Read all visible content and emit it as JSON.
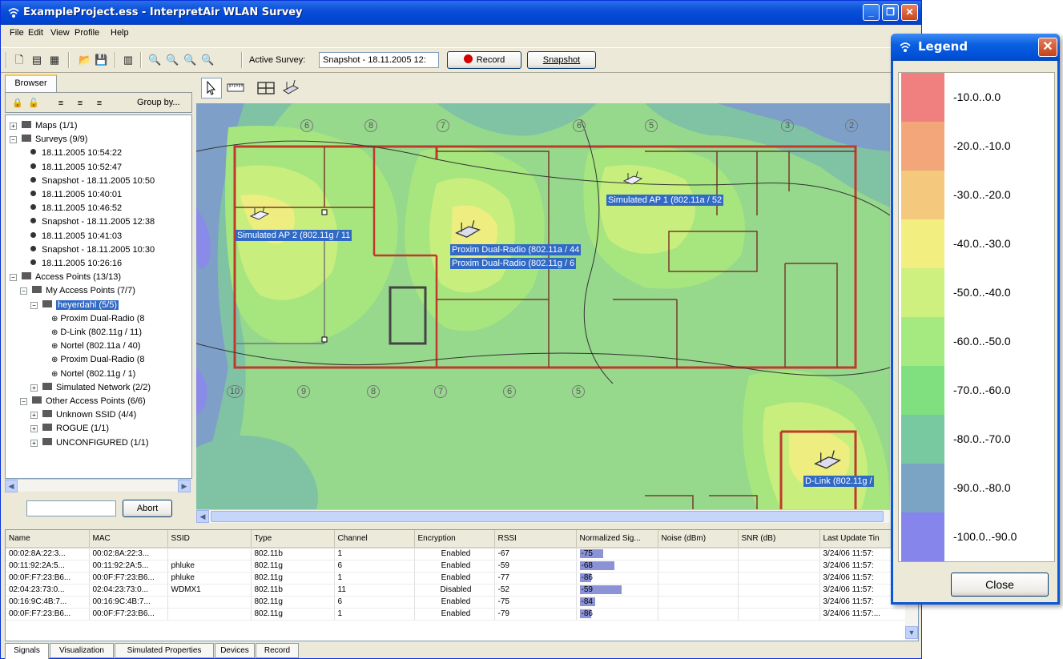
{
  "window": {
    "title": "ExampleProject.ess - InterpretAir WLAN Survey"
  },
  "menu": [
    "File",
    "Edit",
    "View",
    "Profile",
    "Help"
  ],
  "toolbar": {
    "active_survey_label": "Active Survey:",
    "active_survey_value": "Snapshot - 18.11.2005 12:",
    "record_label": "Record",
    "snapshot_label": "Snapshot"
  },
  "browser": {
    "tab_label": "Browser",
    "group_by_label": "Group by...",
    "abort_label": "Abort",
    "tree": [
      {
        "label": "Maps  (1/1)",
        "indent": 0,
        "toggle": "+",
        "kind": "folder"
      },
      {
        "label": "Surveys  (9/9)",
        "indent": 0,
        "toggle": "−",
        "kind": "folder"
      },
      {
        "label": "18.11.2005 10:54:22",
        "indent": 2,
        "kind": "survey"
      },
      {
        "label": "18.11.2005 10:52:47",
        "indent": 2,
        "kind": "survey"
      },
      {
        "label": "Snapshot - 18.11.2005 10:50",
        "indent": 2,
        "kind": "survey"
      },
      {
        "label": "18.11.2005 10:40:01",
        "indent": 2,
        "kind": "survey"
      },
      {
        "label": "18.11.2005 10:46:52",
        "indent": 2,
        "kind": "survey"
      },
      {
        "label": "Snapshot - 18.11.2005 12:38",
        "indent": 2,
        "kind": "survey"
      },
      {
        "label": "18.11.2005 10:41:03",
        "indent": 2,
        "kind": "survey"
      },
      {
        "label": "Snapshot - 18.11.2005 10:30",
        "indent": 2,
        "kind": "survey"
      },
      {
        "label": "18.11.2005 10:26:16",
        "indent": 2,
        "kind": "survey"
      },
      {
        "label": "Access Points  (13/13)",
        "indent": 0,
        "toggle": "−",
        "kind": "group"
      },
      {
        "label": "My Access Points  (7/7)",
        "indent": 1,
        "toggle": "−",
        "kind": "group"
      },
      {
        "label": "heyerdahl  (5/5)",
        "indent": 2,
        "toggle": "−",
        "kind": "group",
        "selected": true
      },
      {
        "label": "Proxim Dual-Radio (8",
        "indent": 4,
        "kind": "ap"
      },
      {
        "label": "D-Link (802.11g / 11)",
        "indent": 4,
        "kind": "ap"
      },
      {
        "label": "Nortel (802.11a / 40)",
        "indent": 4,
        "kind": "ap"
      },
      {
        "label": "Proxim Dual-Radio (8",
        "indent": 4,
        "kind": "ap"
      },
      {
        "label": "Nortel (802.11g / 1)",
        "indent": 4,
        "kind": "ap"
      },
      {
        "label": "Simulated Network  (2/2)",
        "indent": 2,
        "toggle": "+",
        "kind": "group"
      },
      {
        "label": "Other Access Points  (6/6)",
        "indent": 1,
        "toggle": "−",
        "kind": "group"
      },
      {
        "label": "Unknown SSID  (4/4)",
        "indent": 2,
        "toggle": "+",
        "kind": "group"
      },
      {
        "label": "ROGUE  (1/1)",
        "indent": 2,
        "toggle": "+",
        "kind": "group"
      },
      {
        "label": "UNCONFIGURED  (1/1)",
        "indent": 2,
        "toggle": "+",
        "kind": "group"
      }
    ]
  },
  "map": {
    "ap_labels": {
      "ap1": "Simulated AP 1 (802.11a / 52",
      "ap2": "Simulated AP 2 (802.11g / 11",
      "proxim_a": "Proxim Dual-Radio (802.11a / 44",
      "proxim_g": "Proxim Dual-Radio (802.11g / 6",
      "dlink": "D-Link (802.11g /"
    },
    "column_markers_top": [
      "6",
      "8",
      "7",
      "6",
      "5",
      "3",
      "2"
    ],
    "column_markers_bottom": [
      "10",
      "9",
      "8",
      "7",
      "6",
      "5"
    ]
  },
  "table": {
    "columns": [
      "Name",
      "MAC",
      "SSID",
      "Type",
      "Channel",
      "Encryption",
      "RSSI",
      "Normalized Sig...",
      "Noise (dBm)",
      "SNR (dB)",
      "Last Update Tin"
    ],
    "rows": [
      [
        "00:02:8A:22:3...",
        "00:02:8A:22:3...",
        "",
        "802.11b",
        "1",
        "Enabled",
        "-67",
        "-75",
        "",
        "",
        "3/24/06 11:57:"
      ],
      [
        "00:11:92:2A:5...",
        "00:11:92:2A:5...",
        "phluke",
        "802.11g",
        "6",
        "Enabled",
        "-59",
        "-68",
        "",
        "",
        "3/24/06 11:57:"
      ],
      [
        "00:0F:F7:23:B6...",
        "00:0F:F7:23:B6...",
        "phluke",
        "802.11g",
        "1",
        "Enabled",
        "-77",
        "-86",
        "",
        "",
        "3/24/06 11:57:"
      ],
      [
        "02:04:23:73:0...",
        "02:04:23:73:0...",
        "WDMX1",
        "802.11b",
        "11",
        "Disabled",
        "-52",
        "-59",
        "",
        "",
        "3/24/06 11:57:"
      ],
      [
        "00:16:9C:4B:7...",
        "00:16:9C:4B:7...",
        "",
        "802.11g",
        "6",
        "Enabled",
        "-75",
        "-84",
        "",
        "",
        "3/24/06 11:57:"
      ],
      [
        "00:0F:F7:23:B6...",
        "00:0F:F7:23:B6...",
        "",
        "802.11g",
        "1",
        "Enabled",
        "-79",
        "-86",
        "",
        "",
        "3/24/06 11:57:..."
      ]
    ],
    "norm_signal_fill": [
      0.3,
      0.45,
      0.15,
      0.55,
      0.2,
      0.15
    ]
  },
  "bottom_tabs": [
    "Signals",
    "Visualization",
    "Simulated Properties",
    "Devices",
    "Record"
  ],
  "legend": {
    "title": "Legend",
    "close_label": "Close",
    "items": [
      {
        "label": "-10.0..0.0",
        "color": "#f08080"
      },
      {
        "label": "-20.0..-10.0",
        "color": "#f3a67a"
      },
      {
        "label": "-30.0..-20.0",
        "color": "#f5c97d"
      },
      {
        "label": "-40.0..-30.0",
        "color": "#f3ee80"
      },
      {
        "label": "-50.0..-40.0",
        "color": "#cdf07e"
      },
      {
        "label": "-60.0..-50.0",
        "color": "#a4ea80"
      },
      {
        "label": "-70.0..-60.0",
        "color": "#80e080"
      },
      {
        "label": "-80.0..-70.0",
        "color": "#78c9a0"
      },
      {
        "label": "-90.0..-80.0",
        "color": "#7ba4c4"
      },
      {
        "label": "-100.0..-90.0",
        "color": "#8585ec"
      }
    ]
  }
}
